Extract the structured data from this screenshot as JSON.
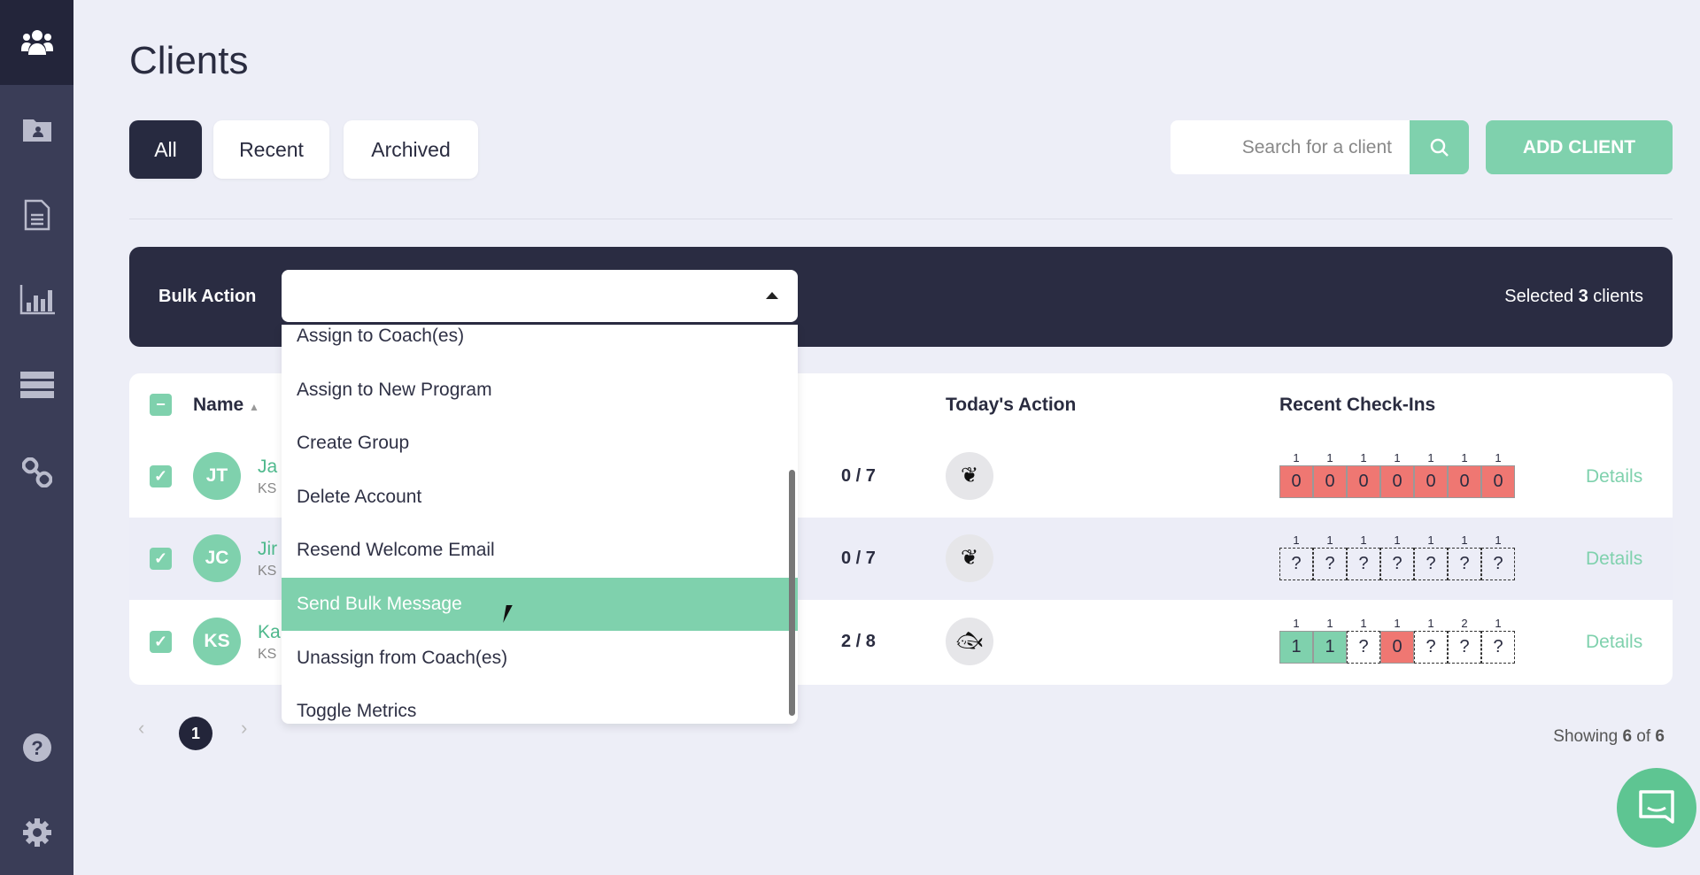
{
  "sidebar": {
    "items": [
      {
        "icon": "users-icon"
      },
      {
        "icon": "contact-folder-icon"
      },
      {
        "icon": "document-icon"
      },
      {
        "icon": "bar-chart-icon"
      },
      {
        "icon": "list-icon"
      },
      {
        "icon": "link-icon"
      },
      {
        "icon": "help-icon"
      },
      {
        "icon": "gear-icon"
      }
    ]
  },
  "header": {
    "title": "Clients"
  },
  "tabs": [
    {
      "label": "All",
      "active": true
    },
    {
      "label": "Recent"
    },
    {
      "label": "Archived"
    }
  ],
  "search": {
    "placeholder": "Search for a client"
  },
  "add_client_label": "ADD CLIENT",
  "bulk": {
    "label": "Bulk Action",
    "selected_prefix": "Selected ",
    "selected_count": "3",
    "selected_suffix": " clients",
    "options": [
      "Assign to Coach(es)",
      "Assign to New Program",
      "Create Group",
      "Delete Account",
      "Resend Welcome Email",
      "Send Bulk Message",
      "Unassign from Coach(es)",
      "Toggle Metrics"
    ],
    "highlighted": "Send Bulk Message"
  },
  "table": {
    "headers": {
      "name": "Name",
      "action": "Today's Action",
      "checkins": "Recent Check-Ins"
    },
    "rows": [
      {
        "initials": "JT",
        "name": "Ja",
        "sub": "KS",
        "progress": "0 / 7",
        "action_icon": "lotus-icon",
        "checkins": [
          [
            "1",
            "0",
            "red"
          ],
          [
            "1",
            "0",
            "red"
          ],
          [
            "1",
            "0",
            "red"
          ],
          [
            "1",
            "0",
            "red"
          ],
          [
            "1",
            "0",
            "red"
          ],
          [
            "1",
            "0",
            "red"
          ],
          [
            "1",
            "0",
            "red"
          ]
        ],
        "details": "Details"
      },
      {
        "initials": "JC",
        "name": "Jir",
        "sub": "KS",
        "progress": "0 / 7",
        "action_icon": "lotus-icon",
        "checkins": [
          [
            "1",
            "?",
            "none"
          ],
          [
            "1",
            "?",
            "none"
          ],
          [
            "1",
            "?",
            "none"
          ],
          [
            "1",
            "?",
            "none"
          ],
          [
            "1",
            "?",
            "none"
          ],
          [
            "1",
            "?",
            "none"
          ],
          [
            "1",
            "?",
            "none"
          ]
        ],
        "details": "Details"
      },
      {
        "initials": "KS",
        "name": "Ka",
        "sub": "KS",
        "progress": "2 / 8",
        "action_icon": "fish-icon",
        "checkins": [
          [
            "1",
            "1",
            "green"
          ],
          [
            "1",
            "1",
            "green"
          ],
          [
            "1",
            "?",
            "none"
          ],
          [
            "1",
            "0",
            "red"
          ],
          [
            "1",
            "?",
            "none"
          ],
          [
            "2",
            "?",
            "none"
          ],
          [
            "1",
            "?",
            "none"
          ]
        ],
        "details": "Details"
      }
    ]
  },
  "pagination": {
    "current": "1",
    "showing_prefix": "Showing ",
    "showing_count": "6",
    "showing_mid": " of ",
    "showing_total": "6"
  },
  "colors": {
    "accent": "#7fd1ad",
    "sidebar": "#3a3d57",
    "dark": "#272a40",
    "red": "#ef7772"
  }
}
